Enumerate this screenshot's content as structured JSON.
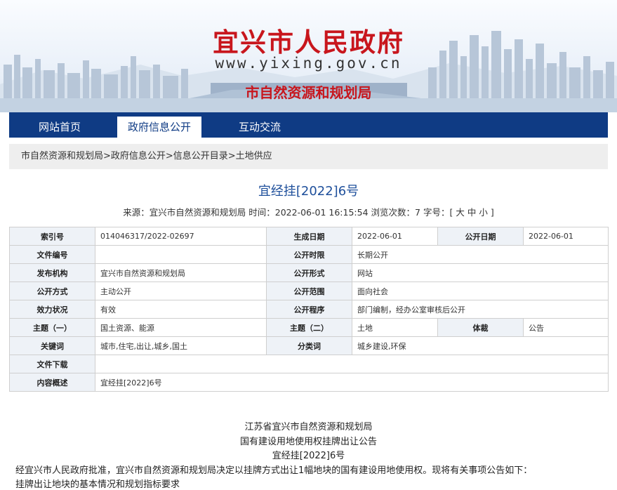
{
  "header": {
    "site_title": "宜兴市人民政府",
    "site_url": "www.yixing.gov.cn",
    "dept_title": "市自然资源和规划局"
  },
  "nav": {
    "items": [
      {
        "label": "网站首页"
      },
      {
        "label": "政府信息公开",
        "active": true
      },
      {
        "label": "互动交流"
      }
    ]
  },
  "breadcrumb": "市自然资源和规划局>政府信息公开>信息公开目录>土地供应",
  "article": {
    "title": "宜经挂[2022]6号",
    "meta": {
      "source_label": "来源：",
      "source": "宜兴市自然资源和规划局",
      "time_label": "时间：",
      "time": "2022-06-01 16:15:54",
      "views_label": "浏览次数：",
      "views": "7",
      "font_label": "字号：[",
      "font_large": "大",
      "font_medium": "中",
      "font_small": "小",
      "font_close": "]"
    }
  },
  "info_table": {
    "index_no_label": "索引号",
    "index_no": "014046317/2022-02697",
    "created_label": "生成日期",
    "created": "2022-06-01",
    "published_label": "公开日期",
    "published": "2022-06-01",
    "doc_no_label": "文件编号",
    "doc_no": "",
    "period_label": "公开时限",
    "period": "长期公开",
    "org_label": "发布机构",
    "org": "宜兴市自然资源和规划局",
    "form_label": "公开形式",
    "form": "网站",
    "method_label": "公开方式",
    "method": "主动公开",
    "scope_label": "公开范围",
    "scope": "面向社会",
    "validity_label": "效力状况",
    "validity": "有效",
    "procedure_label": "公开程序",
    "procedure": "部门编制，经办公室审核后公开",
    "theme1_label": "主题（一）",
    "theme1": "国土资源、能源",
    "theme2_label": "主题（二）",
    "theme2": "土地",
    "genre_label": "体裁",
    "genre": "公告",
    "keywords_label": "关键词",
    "keywords": "城市,住宅,出让,城乡,国土",
    "category_label": "分类词",
    "category": "城乡建设,环保",
    "download_label": "文件下载",
    "download": "",
    "summary_label": "内容概述",
    "summary": "宜经挂[2022]6号"
  },
  "body": {
    "line1": "江苏省宜兴市自然资源和规划局",
    "line2": "国有建设用地使用权挂牌出让公告",
    "line3": "宜经挂[2022]6号",
    "para1": "经宜兴市人民政府批准，宜兴市自然资源和规划局决定以挂牌方式出让1幅地块的国有建设用地使用权。现将有关事项公告如下：",
    "para2": "挂牌出让地块的基本情况和规划指标要求"
  },
  "colors": {
    "brand_red": "#c8161d",
    "nav_blue": "#0f3b84",
    "title_blue": "#1e4f9b"
  }
}
